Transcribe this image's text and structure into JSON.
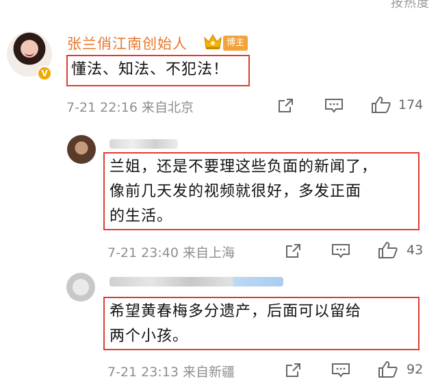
{
  "sort_label": "按热度",
  "main_comment": {
    "username": "张兰俏江南创始人",
    "badge": "博主",
    "verified_glyph": "V",
    "text": "懂法、知法、不犯法！",
    "meta": "7-21 22:16  来自北京",
    "like_count": "174"
  },
  "replies": [
    {
      "text_lines": [
        "兰姐，还是不要理这些负面的新闻了，",
        "像前几天发的视频就很好，多发正面",
        "的生活。"
      ],
      "meta": "7-21 23:40  来自上海",
      "like_count": "43"
    },
    {
      "text_lines": [
        "希望黄春梅多分遗产，后面可以留给",
        "两个小孩。"
      ],
      "meta": "7-21 23:13  来自新疆",
      "like_count": "92"
    }
  ],
  "colors": {
    "username": "#e8762b",
    "highlight_box": "#e03a30",
    "badge": "#f2a23a",
    "meta": "#8e8e8e"
  },
  "icons": [
    "share-icon",
    "comment-icon",
    "like-icon",
    "crown-icon",
    "verified-icon"
  ]
}
